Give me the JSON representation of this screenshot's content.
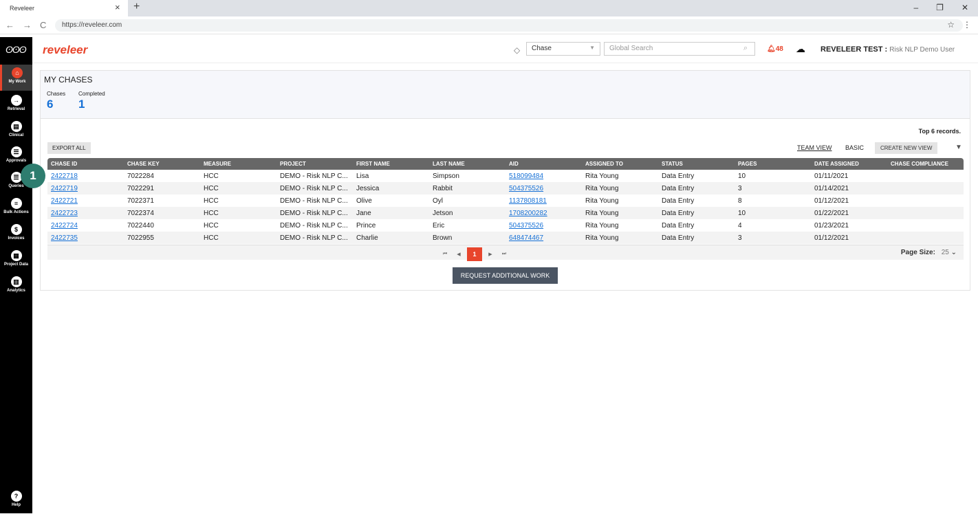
{
  "browser": {
    "tab_title": "Reveleer",
    "tab_close": "×",
    "new_tab": "+",
    "url": "https://reveleer.com",
    "back": "←",
    "forward": "→",
    "reload": "C",
    "star": "☆",
    "menu": "⋮",
    "minimize": "–",
    "restore": "❐",
    "close": "✕"
  },
  "sidebar": {
    "items": [
      {
        "label": "My Work",
        "glyph": "⌂"
      },
      {
        "label": "Retrieval",
        "glyph": "→"
      },
      {
        "label": "Clinical",
        "glyph": "▤"
      },
      {
        "label": "Approvals",
        "glyph": "☰"
      },
      {
        "label": "Queries",
        "glyph": "☰"
      },
      {
        "label": "Bulk Actions",
        "glyph": "≡"
      },
      {
        "label": "Invoices",
        "glyph": "$"
      },
      {
        "label": "Project Data",
        "glyph": "▦"
      },
      {
        "label": "Analytics",
        "glyph": "▥"
      }
    ],
    "help": {
      "label": "Help",
      "glyph": "?"
    }
  },
  "header": {
    "brand": "reveleer",
    "chase_select": "Chase",
    "search_placeholder": "Global Search",
    "alert_count": "48",
    "org": "REVELEER TEST :",
    "user": "Risk NLP Demo User"
  },
  "card": {
    "title": "MY CHASES",
    "chases_label": "Chases",
    "chases_value": "6",
    "completed_label": "Completed",
    "completed_value": "1",
    "top_records": "Top 6 records.",
    "export_all": "EXPORT ALL",
    "team_view": "TEAM VIEW",
    "basic": "BASIC",
    "create_new_view": "CREATE NEW VIEW",
    "request_work": "REQUEST ADDITIONAL WORK"
  },
  "table": {
    "columns": [
      "CHASE ID",
      "CHASE KEY",
      "MEASURE",
      "PROJECT",
      "FIRST NAME",
      "LAST NAME",
      "AID",
      "ASSIGNED TO",
      "STATUS",
      "PAGES",
      "DATE ASSIGNED",
      "CHASE COMPLIANCE"
    ],
    "rows": [
      [
        "2422718",
        "7022284",
        "HCC",
        "DEMO - Risk NLP C...",
        "Lisa",
        "Simpson",
        "518099484",
        "Rita Young",
        "Data Entry",
        "10",
        "01/11/2021",
        ""
      ],
      [
        "2422719",
        "7022291",
        "HCC",
        "DEMO - Risk NLP C...",
        "Jessica",
        "Rabbit",
        "504375526",
        "Rita Young",
        "Data Entry",
        "3",
        "01/14/2021",
        ""
      ],
      [
        "2422721",
        "7022371",
        "HCC",
        "DEMO - Risk NLP C...",
        "Olive",
        "Oyl",
        "1137808181",
        "Rita Young",
        "Data Entry",
        "8",
        "01/12/2021",
        ""
      ],
      [
        "2422723",
        "7022374",
        "HCC",
        "DEMO - Risk NLP C...",
        "Jane",
        "Jetson",
        "1708200282",
        "Rita Young",
        "Data Entry",
        "10",
        "01/22/2021",
        ""
      ],
      [
        "2422724",
        "7022440",
        "HCC",
        "DEMO - Risk NLP C...",
        "Prince",
        "Eric",
        "504375526",
        "Rita Young",
        "Data Entry",
        "4",
        "01/23/2021",
        ""
      ],
      [
        "2422735",
        "7022955",
        "HCC",
        "DEMO - Risk NLP C...",
        "Charlie",
        "Brown",
        "648474467",
        "Rita Young",
        "Data Entry",
        "3",
        "01/12/2021",
        ""
      ]
    ]
  },
  "pager": {
    "current_page": "1",
    "page_size_label": "Page Size:",
    "page_size_value": "25"
  },
  "step_badge": "1",
  "colors": {
    "accent": "#e8452c",
    "link": "#1570d6",
    "header_row": "#676767"
  }
}
